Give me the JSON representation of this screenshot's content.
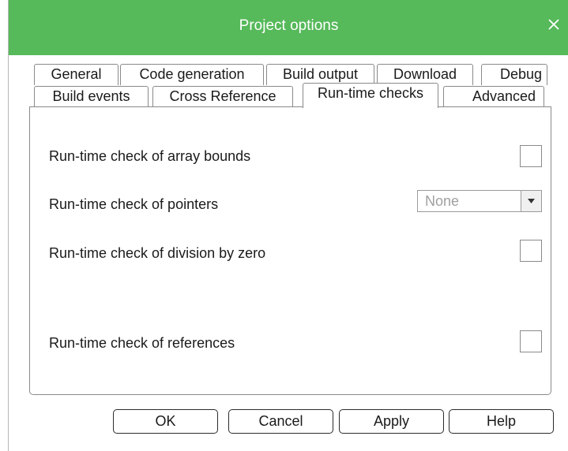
{
  "window": {
    "title": "Project options",
    "close_icon": "close-icon",
    "title_bar_color": "#56b95a"
  },
  "tabs": {
    "row_back": [
      {
        "label": "General"
      },
      {
        "label": "Code generation"
      },
      {
        "label": "Build output"
      },
      {
        "label": "Download"
      },
      {
        "label": "Debug"
      }
    ],
    "row_front": [
      {
        "label": "Build events"
      },
      {
        "label": "Cross Reference"
      },
      {
        "label": "Run-time checks",
        "active": true
      },
      {
        "label": "Advanced"
      }
    ]
  },
  "options": {
    "array_bounds": {
      "label": "Run-time check of array bounds",
      "checked": false
    },
    "pointers": {
      "label": "Run-time check of pointers",
      "value": "None"
    },
    "division_by_zero": {
      "label": "Run-time check of division by zero",
      "checked": false
    },
    "references": {
      "label": "Run-time check of references",
      "checked": false
    }
  },
  "buttons": {
    "ok": "OK",
    "cancel": "Cancel",
    "apply": "Apply",
    "help": "Help"
  }
}
